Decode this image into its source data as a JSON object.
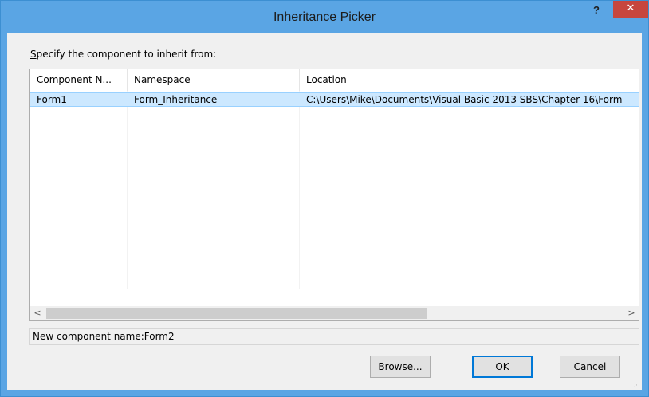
{
  "window": {
    "title": "Inheritance Picker",
    "help_label": "?",
    "close_label": "✕"
  },
  "prompt": {
    "mnemonic": "S",
    "rest": "pecify the component to inherit from:"
  },
  "list": {
    "columns": [
      "Component N...",
      "Namespace",
      "Location"
    ],
    "rows": [
      {
        "component": "Form1",
        "namespace": "Form_Inheritance",
        "location": "C:\\Users\\Mike\\Documents\\Visual Basic 2013 SBS\\Chapter 16\\Form"
      }
    ],
    "scroll_left": "<",
    "scroll_right": ">"
  },
  "status_text": "New component name:Form2",
  "buttons": {
    "browse_mnemonic": "B",
    "browse_rest": "rowse...",
    "ok": "OK",
    "cancel": "Cancel"
  },
  "colors": {
    "titlebar": "#5aa5e4",
    "close_button": "#c7463e",
    "selection": "#cce8ff"
  }
}
